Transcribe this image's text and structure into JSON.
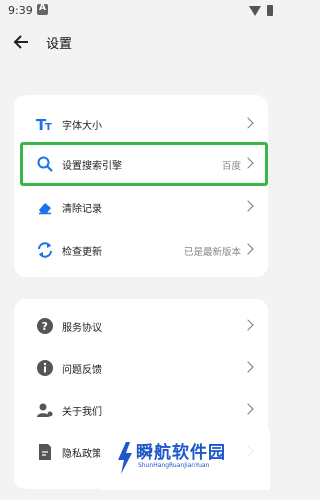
{
  "status_bar": {
    "time": "9:39"
  },
  "header": {
    "title": "设置"
  },
  "card1": {
    "items": [
      {
        "label": "字体大小",
        "value": ""
      },
      {
        "label": "设置搜索引擎",
        "value": "百度"
      },
      {
        "label": "清除记录",
        "value": ""
      },
      {
        "label": "检查更新",
        "value": "已是最新版本"
      }
    ]
  },
  "card2": {
    "items": [
      {
        "label": "服务协议"
      },
      {
        "label": "问题反馈"
      },
      {
        "label": "关于我们"
      },
      {
        "label": "隐私政策"
      }
    ]
  },
  "watermark": {
    "title": "瞬航软件园",
    "subtitle": "ShunHangRuanJianYuan"
  },
  "colors": {
    "highlight": "#39b54a",
    "accent": "#1a73e8",
    "brand": "#1d57c9"
  }
}
